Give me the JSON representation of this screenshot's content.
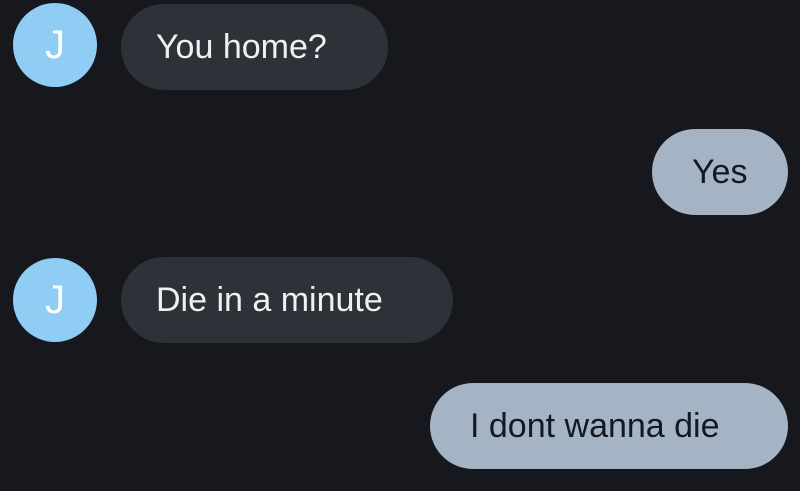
{
  "conversation": {
    "messages": [
      {
        "sender_initial": "J",
        "text": "You home?"
      },
      {
        "text": "Yes"
      },
      {
        "sender_initial": "J",
        "text": "Die in a minute"
      },
      {
        "text": "I dont wanna die"
      }
    ]
  },
  "colors": {
    "background": "#17181d",
    "incoming_bubble": "#2f3139",
    "outgoing_bubble": "#a5b4c4",
    "avatar": "#8fcdf5"
  }
}
